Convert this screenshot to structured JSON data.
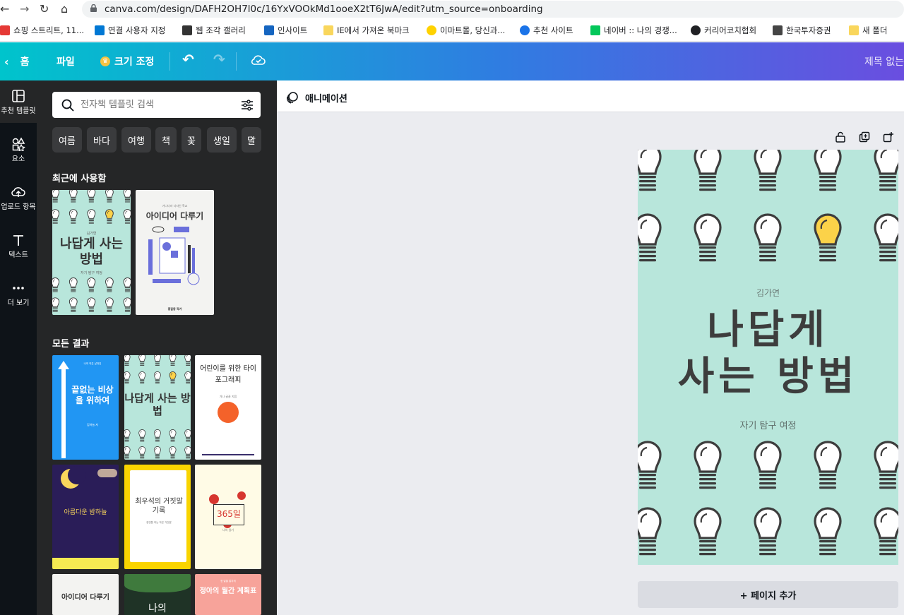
{
  "browser": {
    "url": "canva.com/design/DAFH2OH7l0c/16YxVOOkMd1ooeX2tT6JwA/edit?utm_source=onboarding",
    "bookmarks": [
      {
        "label": "쇼핑 스트리트, 11...",
        "icon": "shopping-icon",
        "color": "#e53935"
      },
      {
        "label": "연결 사용자 지정",
        "icon": "windows-icon",
        "color": "#0078d4"
      },
      {
        "label": "웹 조각 갤러리",
        "icon": "webslice-icon",
        "color": "#333333"
      },
      {
        "label": "인사이트",
        "icon": "insight-icon",
        "color": "#1565c0"
      },
      {
        "label": "IE에서 가져온 북마크",
        "icon": "folder-icon",
        "color": "#f9d65c"
      },
      {
        "label": "이마트몰, 당신과...",
        "icon": "emart-icon",
        "color": "#ffd200"
      },
      {
        "label": "추천 사이트",
        "icon": "search-icon",
        "color": "#1a73e8"
      },
      {
        "label": "네이버 :: 나의 경쟁...",
        "icon": "naver-icon",
        "color": "#03c75a"
      },
      {
        "label": "커리어코치협회",
        "icon": "globe-icon",
        "color": "#202124"
      },
      {
        "label": "한국투자증권",
        "icon": "runner-icon",
        "color": "#444444"
      },
      {
        "label": "새 폴더",
        "icon": "folder-icon",
        "color": "#f9d65c"
      }
    ]
  },
  "topbar": {
    "home": "홈",
    "file": "파일",
    "resize": "크기 조정",
    "title": "제목 없는"
  },
  "rail": [
    {
      "label": "추천 템플릿",
      "icon": "template-icon"
    },
    {
      "label": "요소",
      "icon": "elements-icon"
    },
    {
      "label": "업로드 항목",
      "icon": "upload-icon"
    },
    {
      "label": "텍스트",
      "icon": "text-icon"
    },
    {
      "label": "더 보기",
      "icon": "more-icon"
    }
  ],
  "panel": {
    "search_placeholder": "전자책 템플릿 검색",
    "chips": [
      "여름",
      "바다",
      "여행",
      "책",
      "꽃",
      "생일",
      "달"
    ],
    "recent_heading": "최근에 사용함",
    "all_heading": "모든 결과",
    "recent": [
      {
        "title": "나답게 사는 방법",
        "author": "김가연",
        "subtitle": "자기 탐구 여정"
      },
      {
        "title": "아이디어 다루기",
        "caption": "가나다라 디자인 학교",
        "author": "홍길동 작가"
      }
    ],
    "results": [
      {
        "title": "끝없는 비상을 위하여",
        "caption": "나의 작은 날개짓",
        "author": "김하늘 저"
      },
      {
        "title": "나답게 사는 방법"
      },
      {
        "title": "어린이를 위한 타이포그래피",
        "author": "가나 글꼴 지음"
      },
      {
        "title": "아름다운 밤하늘"
      },
      {
        "title": "최우석의 거짓말 기록",
        "caption": "한번쯤 하는 작은 거짓말"
      },
      {
        "title": "365일",
        "caption": "나의 일기"
      },
      {
        "title": "아이디어 다루기"
      },
      {
        "title": "나의"
      },
      {
        "title": "정아의 월간 계획표",
        "caption": "한 달을 알차게"
      }
    ]
  },
  "canvas": {
    "animation_label": "애니메이션",
    "author": "김가연",
    "title_line1": "나답게",
    "title_line2": "사는 방법",
    "subtitle": "자기 탐구 여정",
    "add_page": "+ 페이지 추가",
    "page_bg": "#b8e6db",
    "bulb_highlight": "#fbd249"
  }
}
